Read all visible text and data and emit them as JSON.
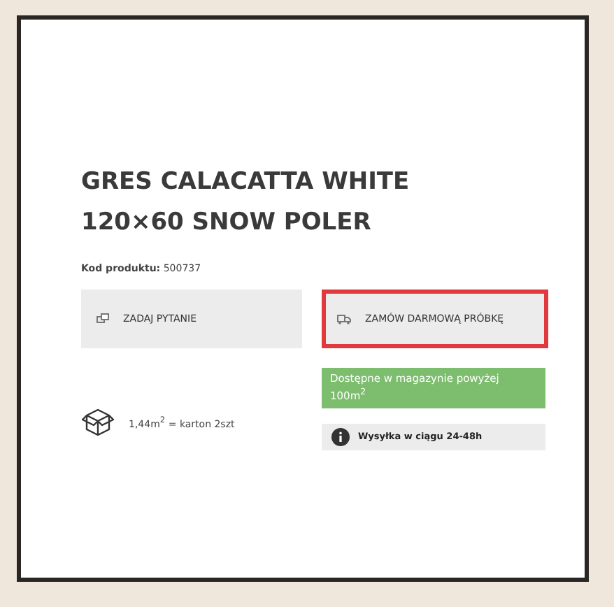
{
  "product": {
    "title": "GRES CALACATTA WHITE 120×60 SNOW POLER",
    "code_label": "Kod produktu:",
    "code": "500737"
  },
  "actions": [
    {
      "label": "ZADAJ PYTANIE",
      "kind": "question",
      "selected": false
    },
    {
      "label": "ZAMÓW DARMOWĄ PRÓBKĘ",
      "kind": "sample",
      "selected": true
    }
  ],
  "packaging": "1,44m$^{2}$ = karton 2szt",
  "availability": "Dostępne w magazynie powyżej 100m$^{2}$",
  "shipping": "Wysyłka w ciągu 24-48h"
}
